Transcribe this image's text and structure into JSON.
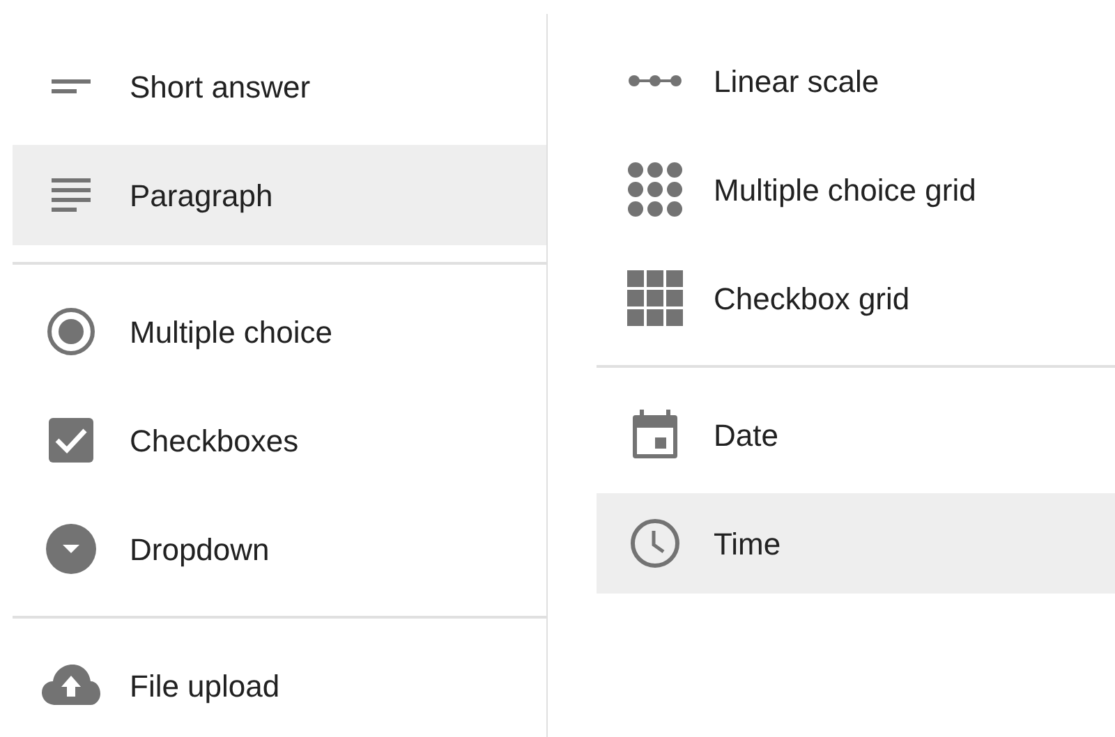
{
  "columns": [
    {
      "groups": [
        [
          {
            "label": "Short answer",
            "kind": "short",
            "selected": false
          },
          {
            "label": "Paragraph",
            "kind": "paragraph",
            "selected": true
          }
        ],
        [
          {
            "label": "Multiple choice",
            "kind": "radio",
            "selected": false
          },
          {
            "label": "Checkboxes",
            "kind": "checkbox",
            "selected": false
          },
          {
            "label": "Dropdown",
            "kind": "dropdown",
            "selected": false
          }
        ],
        [
          {
            "label": "File upload",
            "kind": "upload",
            "selected": false
          }
        ]
      ]
    },
    {
      "groups": [
        [
          {
            "label": "Linear scale",
            "kind": "linear",
            "selected": false
          },
          {
            "label": "Multiple choice grid",
            "kind": "dotgrid",
            "selected": false
          },
          {
            "label": "Checkbox grid",
            "kind": "squaregrid",
            "selected": false
          }
        ],
        [
          {
            "label": "Date",
            "kind": "date",
            "selected": false
          },
          {
            "label": "Time",
            "kind": "time",
            "selected": true
          }
        ]
      ]
    }
  ]
}
